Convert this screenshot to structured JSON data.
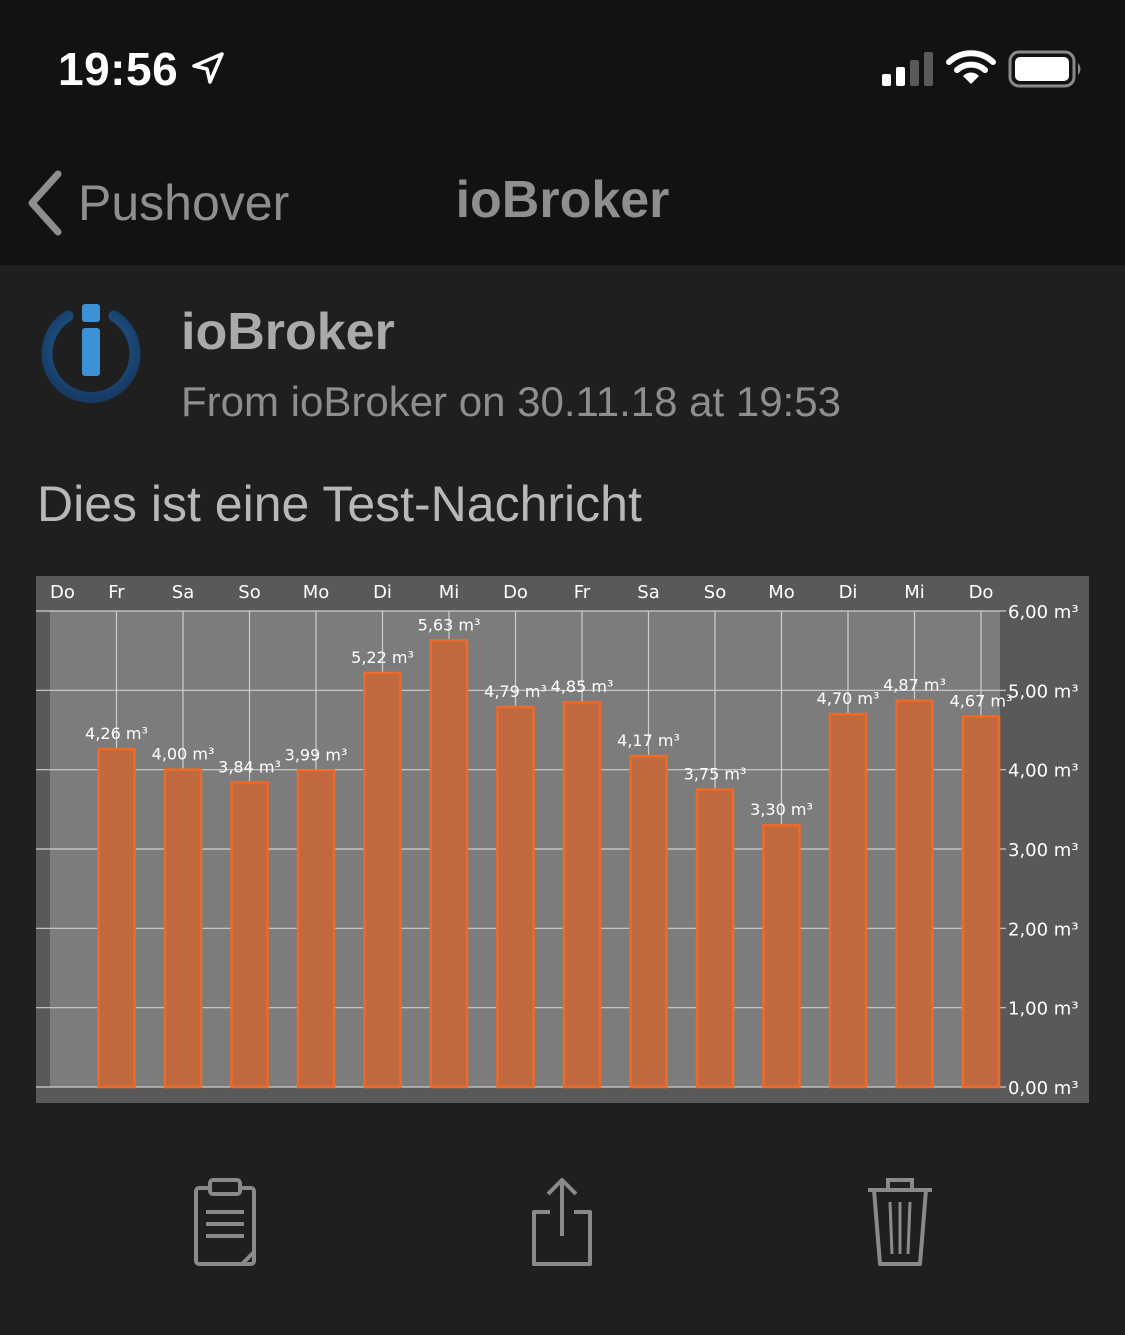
{
  "status_bar": {
    "time": "19:56",
    "location_icon": "location-arrow-icon",
    "signal_icon": "cellular-signal-icon",
    "wifi_icon": "wifi-icon",
    "battery_icon": "battery-icon"
  },
  "nav": {
    "back_label": "Pushover",
    "title": "ioBroker"
  },
  "message": {
    "app_icon": "iobroker-logo-icon",
    "sender": "ioBroker",
    "meta": "From ioBroker on 30.11.18 at 19:53",
    "body": "Dies ist eine Test-Nachricht"
  },
  "actions": {
    "copy_icon": "clipboard-icon",
    "share_icon": "share-icon",
    "delete_icon": "trash-icon"
  },
  "colors": {
    "bar_fill": "#c0693e",
    "bar_stroke": "#ee6a28",
    "plot_bg": "#7c7c7c",
    "chart_frame": "#595959",
    "label_text": "#ffffff"
  },
  "chart_data": {
    "type": "bar",
    "categories": [
      "Fr",
      "Sa",
      "So",
      "Mo",
      "Di",
      "Mi",
      "Do",
      "Fr",
      "Sa",
      "So",
      "Mo",
      "Di",
      "Mi",
      "Do"
    ],
    "values": [
      4.26,
      4.0,
      3.84,
      3.99,
      5.22,
      5.63,
      4.79,
      4.85,
      4.17,
      3.75,
      3.3,
      4.7,
      4.87,
      4.67
    ],
    "value_labels": [
      "4,26 m³",
      "4,00 m³",
      "3,84 m³",
      "3,99 m³",
      "5,22 m³",
      "5,63 m³",
      "4,79 m³",
      "4,85 m³",
      "4,17 m³",
      "3,75 m³",
      "3,30 m³",
      "4,70 m³",
      "4,87 m³",
      "4,67 m³"
    ],
    "top_axis_labels": [
      "Do",
      "Fr",
      "Sa",
      "So",
      "Mo",
      "Di",
      "Mi",
      "Do",
      "Fr",
      "Sa",
      "So",
      "Mo",
      "Di",
      "Mi",
      "Do"
    ],
    "y_ticks": [
      0,
      1,
      2,
      3,
      4,
      5,
      6
    ],
    "y_tick_labels": [
      "0,00 m³",
      "1,00 m³",
      "2,00 m³",
      "3,00 m³",
      "4,00 m³",
      "5,00 m³",
      "6,00 m³"
    ],
    "ylim": [
      0,
      6
    ],
    "y_axis_position": "right",
    "x_axis_position": "top",
    "grid": true
  }
}
